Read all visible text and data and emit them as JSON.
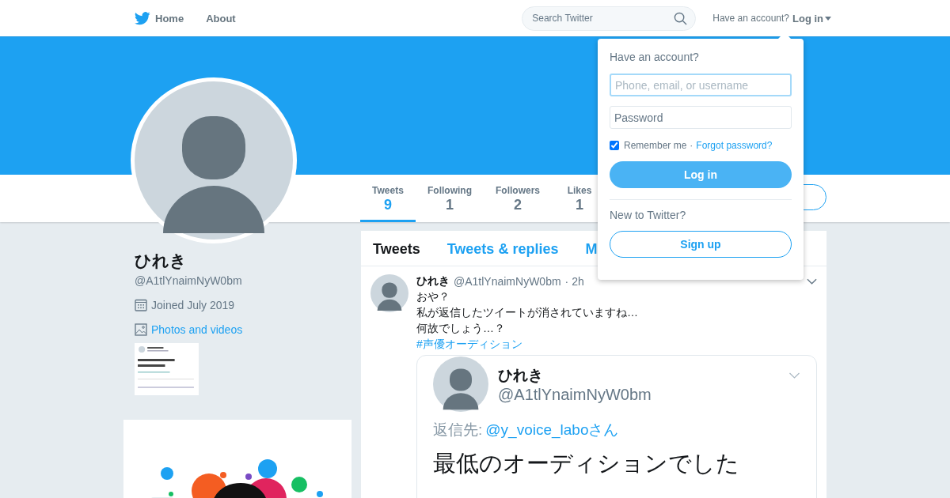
{
  "nav": {
    "items": [
      {
        "label": "Home",
        "kind": "home"
      },
      {
        "label": "About",
        "kind": "plain"
      }
    ],
    "search": {
      "placeholder": "Search Twitter"
    },
    "account_prompt": "Have an account?",
    "login_menu": "Log in"
  },
  "profile": {
    "name": "ひれき",
    "handle": "@A1tlYnaimNyW0bm",
    "joined": "Joined July 2019",
    "photos_link": "Photos and videos"
  },
  "stats": [
    {
      "label": "Tweets",
      "value": "9",
      "selected": true
    },
    {
      "label": "Following",
      "value": "1",
      "selected": false
    },
    {
      "label": "Followers",
      "value": "2",
      "selected": false
    },
    {
      "label": "Likes",
      "value": "1",
      "selected": false
    }
  ],
  "timeline_tabs": [
    {
      "label": "Tweets",
      "selected": true
    },
    {
      "label": "Tweets & replies",
      "selected": false
    },
    {
      "label": "M",
      "selected": false
    }
  ],
  "tweet": {
    "name": "ひれき",
    "handle": "@A1tlYnaimNyW0bm",
    "time": "· 2h",
    "lines": [
      "おや？",
      "私が返信したツイートが消されていますね…",
      "何故でしょう…？"
    ],
    "hashtag": "#声優オーディション",
    "embedded": {
      "name": "ひれき",
      "handle": "@A1tlYnaimNyW0bm",
      "reply_label": "返信先:",
      "reply_to": "@y_voice_laboさん",
      "text": "最低のオーディションでした"
    }
  },
  "login_dropdown": {
    "title": "Have an account?",
    "username_placeholder": "Phone, email, or username",
    "password_placeholder": "Password",
    "remember": {
      "label": "Remember me",
      "checked": true
    },
    "separator": "·",
    "forgot": "Forgot password?",
    "login_button": "Log in",
    "new_prompt": "New to Twitter?",
    "signup_button": "Sign up"
  }
}
